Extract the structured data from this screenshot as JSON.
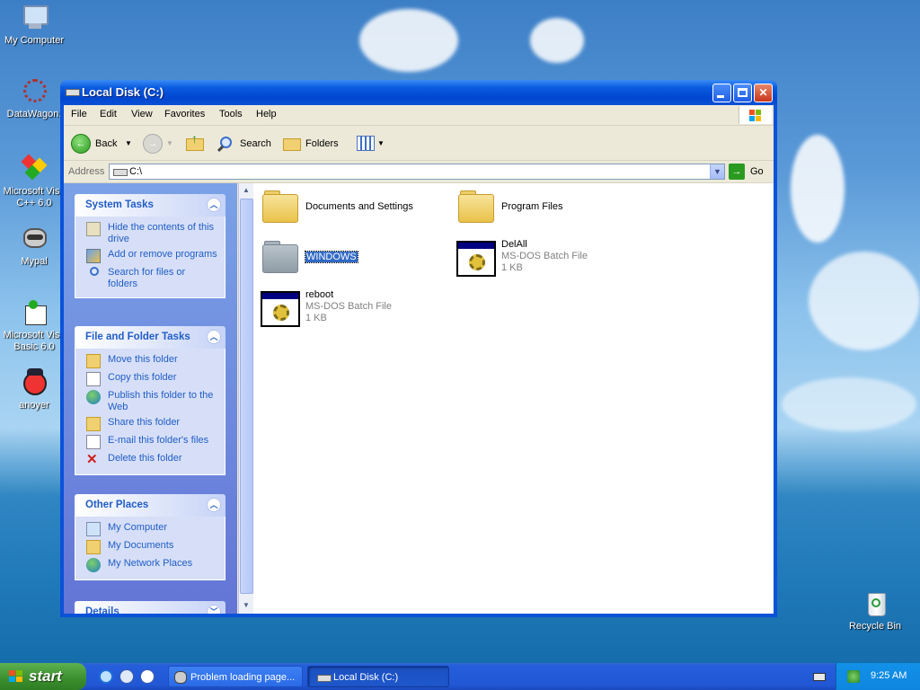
{
  "desktop": {
    "icons": [
      {
        "label": "My Computer"
      },
      {
        "label": "DataWagon."
      },
      {
        "label": "Microsoft Visu C++ 6.0"
      },
      {
        "label": "Mypal"
      },
      {
        "label": "Microsoft Visu Basic 6.0"
      },
      {
        "label": "anoyer"
      },
      {
        "label": "Recycle Bin"
      }
    ]
  },
  "window": {
    "title": "Local Disk (C:)",
    "menu": [
      "File",
      "Edit",
      "View",
      "Favorites",
      "Tools",
      "Help"
    ],
    "toolbar": {
      "back": "Back",
      "search": "Search",
      "folders": "Folders"
    },
    "address": {
      "label": "Address",
      "value": "C:\\",
      "go": "Go"
    },
    "task_pane": {
      "system_tasks": {
        "title": "System Tasks",
        "items": [
          "Hide the contents of this drive",
          "Add or remove programs",
          "Search for files or folders"
        ]
      },
      "file_folder_tasks": {
        "title": "File and Folder Tasks",
        "items": [
          "Move this folder",
          "Copy this folder",
          "Publish this folder to the Web",
          "Share this folder",
          "E-mail this folder's files",
          "Delete this folder"
        ]
      },
      "other_places": {
        "title": "Other Places",
        "items": [
          "My Computer",
          "My Documents",
          "My Network Places"
        ]
      },
      "details": {
        "title": "Details"
      }
    },
    "files": [
      {
        "name": "Documents and Settings",
        "type": "",
        "size": ""
      },
      {
        "name": "Program Files",
        "type": "",
        "size": ""
      },
      {
        "name": "WINDOWS",
        "type": "",
        "size": ""
      },
      {
        "name": "DelAll",
        "type": "MS-DOS Batch File",
        "size": "1 KB"
      },
      {
        "name": "reboot",
        "type": "MS-DOS Batch File",
        "size": "1 KB"
      }
    ]
  },
  "taskbar": {
    "start": "start",
    "tasks": [
      "Problem loading page...",
      "Local Disk (C:)"
    ],
    "clock": "9:25 AM"
  }
}
